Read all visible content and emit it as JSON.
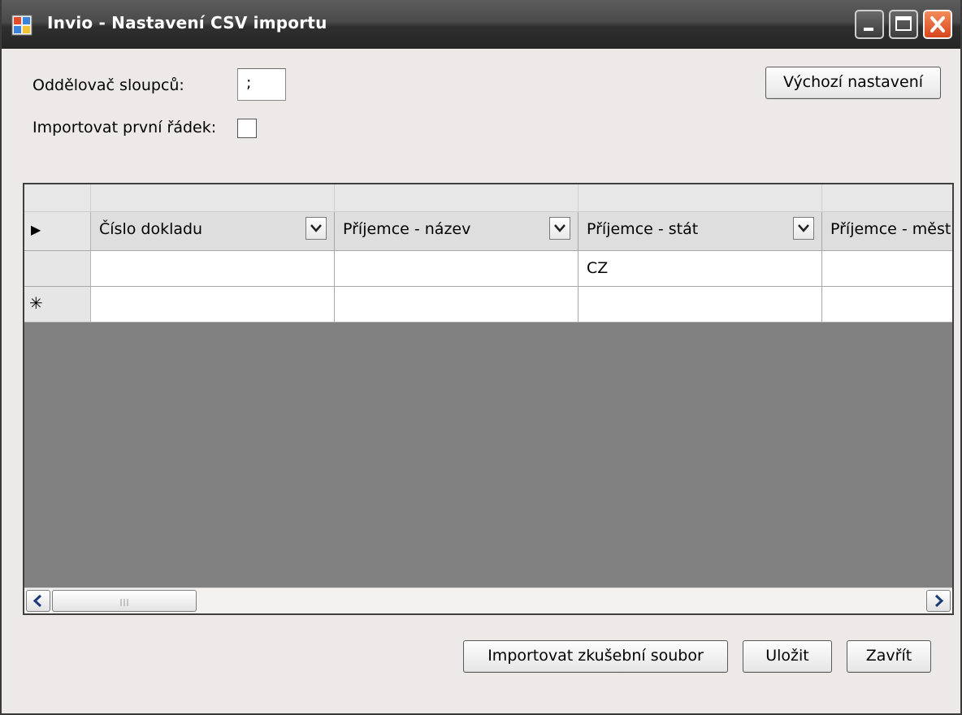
{
  "window": {
    "title": "Invio - Nastavení CSV importu"
  },
  "settings": {
    "separator_label": "Oddělovač sloupců:",
    "separator_value": ";",
    "import_first_row_label": "Importovat první řádek:",
    "import_first_row_checked": false,
    "defaults_button": "Výchozí nastavení"
  },
  "grid": {
    "columns": [
      {
        "header": "Číslo dokladu"
      },
      {
        "header": "Příjemce - název"
      },
      {
        "header": "Příjemce - stát"
      },
      {
        "header": "Příjemce - měst"
      }
    ],
    "row_indicator": "▶",
    "new_row_indicator": "✳",
    "rows": [
      [
        "",
        "",
        "CZ",
        ""
      ]
    ]
  },
  "footer": {
    "import_test_button": "Importovat zkušební soubor",
    "save_button": "Uložit",
    "close_button": "Zavřít"
  },
  "icons": {
    "app": "app-window-icon",
    "minimize": "minimize-icon",
    "maximize": "maximize-icon",
    "close": "close-icon",
    "dropdown": "chevron-down-icon",
    "scroll_left": "arrow-left-icon",
    "scroll_right": "arrow-right-icon"
  },
  "colors": {
    "titlebar": "#3a3a3a",
    "close_button": "#e0582a",
    "window_bg": "#ece9e8",
    "grid_bg": "#818181"
  }
}
